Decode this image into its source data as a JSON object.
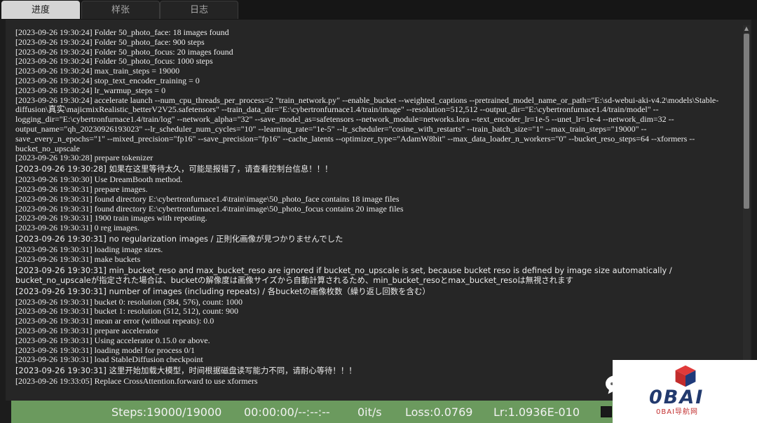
{
  "tabs": [
    {
      "label": "进度",
      "active": true
    },
    {
      "label": "样张",
      "active": false
    },
    {
      "label": "日志",
      "active": false
    }
  ],
  "log_lines": [
    "[2023-09-26 19:30:24] Folder 50_photo_face: 18 images found",
    "[2023-09-26 19:30:24] Folder 50_photo_face: 900 steps",
    "[2023-09-26 19:30:24] Folder 50_photo_focus: 20 images found",
    "[2023-09-26 19:30:24] Folder 50_photo_focus: 1000 steps",
    "[2023-09-26 19:30:24] max_train_steps = 19000",
    "[2023-09-26 19:30:24] stop_text_encoder_training = 0",
    "[2023-09-26 19:30:24] lr_warmup_steps = 0",
    "[2023-09-26 19:30:24] accelerate launch --num_cpu_threads_per_process=2 \"train_network.py\" --enable_bucket --weighted_captions --pretrained_model_name_or_path=\"E:\\sd-webui-aki-v4.2\\models\\Stable-diffusion\\真实\\majicmixRealistic_betterV2V25.safetensors\" --train_data_dir=\"E:\\cybertronfurnace1.4/train/image\" --resolution=512,512 --output_dir=\"E:\\cybertronfurnace1.4/train/model\" --logging_dir=\"E:\\cybertronfurnace1.4/train/log\" --network_alpha=\"32\" --save_model_as=safetensors --network_module=networks.lora --text_encoder_lr=1e-5 --unet_lr=1e-4 --network_dim=32 --output_name=\"qh_20230926193023\" --lr_scheduler_num_cycles=\"10\" --learning_rate=\"1e-5\" --lr_scheduler=\"cosine_with_restarts\" --train_batch_size=\"1\" --max_train_steps=\"19000\" --save_every_n_epochs=\"1\" --mixed_precision=\"fp16\" --save_precision=\"fp16\" --cache_latents --optimizer_type=\"AdamW8bit\" --max_data_loader_n_workers=\"0\" --bucket_reso_steps=64 --xformers --bucket_no_upscale",
    "[2023-09-26 19:30:28] prepare tokenizer",
    "[2023-09-26 19:30:28] 如果在这里等待太久，可能是报错了，请查看控制台信息！！！",
    "[2023-09-26 19:30:30] Use DreamBooth method.",
    "[2023-09-26 19:30:31] prepare images.",
    "[2023-09-26 19:30:31] found directory E:\\cybertronfurnace1.4\\train\\image\\50_photo_face contains 18 image files",
    "[2023-09-26 19:30:31] found directory E:\\cybertronfurnace1.4\\train\\image\\50_photo_focus contains 20 image files",
    "[2023-09-26 19:30:31] 1900 train images with repeating.",
    "[2023-09-26 19:30:31] 0 reg images.",
    "[2023-09-26 19:30:31] no regularization images / 正則化画像が見つかりませんでした",
    "[2023-09-26 19:30:31] loading image sizes.",
    "[2023-09-26 19:30:31] make buckets",
    "[2023-09-26 19:30:31] min_bucket_reso and max_bucket_reso are ignored if bucket_no_upscale is set, because bucket reso is defined by image size automatically / bucket_no_upscaleが指定された場合は、bucketの解像度は画像サイズから自動計算されるため、min_bucket_resoとmax_bucket_resoは無視されます",
    "[2023-09-26 19:30:31] number of images (including repeats) / 各bucketの画像枚数（繰り返し回数を含む）",
    "[2023-09-26 19:30:31] bucket 0: resolution (384, 576), count: 1000",
    "[2023-09-26 19:30:31] bucket 1: resolution (512, 512), count: 900",
    "[2023-09-26 19:30:31] mean ar error (without repeats): 0.0",
    "[2023-09-26 19:30:31] prepare accelerator",
    "[2023-09-26 19:30:31] Using accelerator 0.15.0 or above.",
    "[2023-09-26 19:30:31] loading model for process 0/1",
    "[2023-09-26 19:30:31] load StableDiffusion checkpoint",
    "[2023-09-26 19:30:31] 这里开始加载大模型，时间根据磁盘读写能力不同，请耐心等待！！！",
    "[2023-09-26 19:33:05] Replace CrossAttention.forward to use xformers"
  ],
  "status": {
    "steps": "Steps:19000/19000",
    "time": "00:00:00/--:--:--",
    "rate": "0it/s",
    "loss": "Loss:0.0769",
    "lr": "Lr:1.0936E-010",
    "color": "#6b9a5e"
  },
  "icons": {
    "chat": "chat-bubble-icon",
    "stop": "stop-square-icon"
  },
  "watermark": {
    "brand": "0BAI",
    "sub": "0BAI导航网"
  }
}
